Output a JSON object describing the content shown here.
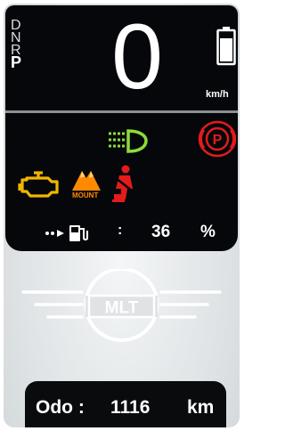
{
  "gear": {
    "options": [
      "D",
      "N",
      "R",
      "P"
    ],
    "active": "P"
  },
  "speed": {
    "value": "0",
    "unit": "km/h"
  },
  "battery": {
    "level_fraction": 0.8,
    "icon": "battery-icon"
  },
  "indicators": {
    "headlight": {
      "icon": "headlight-icon",
      "color": "#8bdc3a"
    },
    "parking_brake": {
      "icon": "parking-brake-icon",
      "color": "#e31b1b"
    },
    "engine": {
      "icon": "engine-warning-icon",
      "color": "#f2b600"
    },
    "mount": {
      "icon": "mount-mode-icon",
      "label": "MOUNT",
      "color": "#ff8a00"
    },
    "seatbelt": {
      "icon": "seatbelt-icon",
      "color": "#e31b1b"
    }
  },
  "fuel": {
    "icon": "fuel-pump-icon",
    "separator": ":",
    "value": "36",
    "unit": "%"
  },
  "logo": {
    "text": "MLT"
  },
  "odometer": {
    "label": "Odo :",
    "value": "1116",
    "unit": "km"
  }
}
